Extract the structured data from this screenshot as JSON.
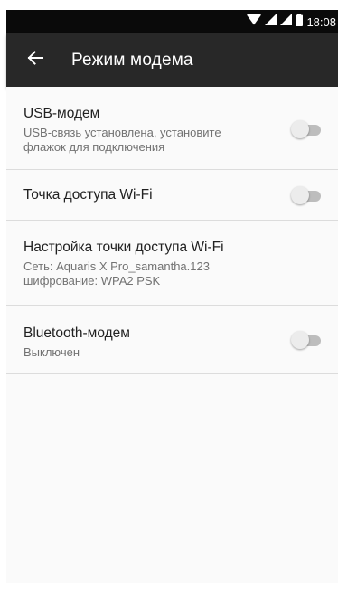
{
  "status_bar": {
    "time": "18:08",
    "icons": [
      "wifi-icon",
      "signal-icon",
      "signal-icon",
      "battery-icon"
    ]
  },
  "app_bar": {
    "back_icon": "arrow-left-icon",
    "title": "Режим модема"
  },
  "settings": [
    {
      "title": "USB-модем",
      "subtitle_lines": [
        "USB-связь установлена, установите",
        "флажок для подключения"
      ],
      "has_toggle": true,
      "toggle_on": false
    },
    {
      "title": "Точка доступа Wi-Fi",
      "subtitle_lines": [],
      "has_toggle": true,
      "toggle_on": false
    },
    {
      "title": "Настройка точки доступа Wi-Fi",
      "subtitle_lines": [
        "Сеть: Aquaris X Pro_samantha.123",
        "шифрование: WPA2 PSK"
      ],
      "has_toggle": false
    },
    {
      "title": "Bluetooth-модем",
      "subtitle_lines": [
        "Выключен"
      ],
      "has_toggle": true,
      "toggle_on": false
    }
  ],
  "colors": {
    "status_bar_bg": "#0a0a0a",
    "app_bar_bg": "#282828",
    "content_bg": "#fafafa",
    "toggle_track_off": "#bdbdbd",
    "toggle_thumb_off": "#ececec"
  }
}
